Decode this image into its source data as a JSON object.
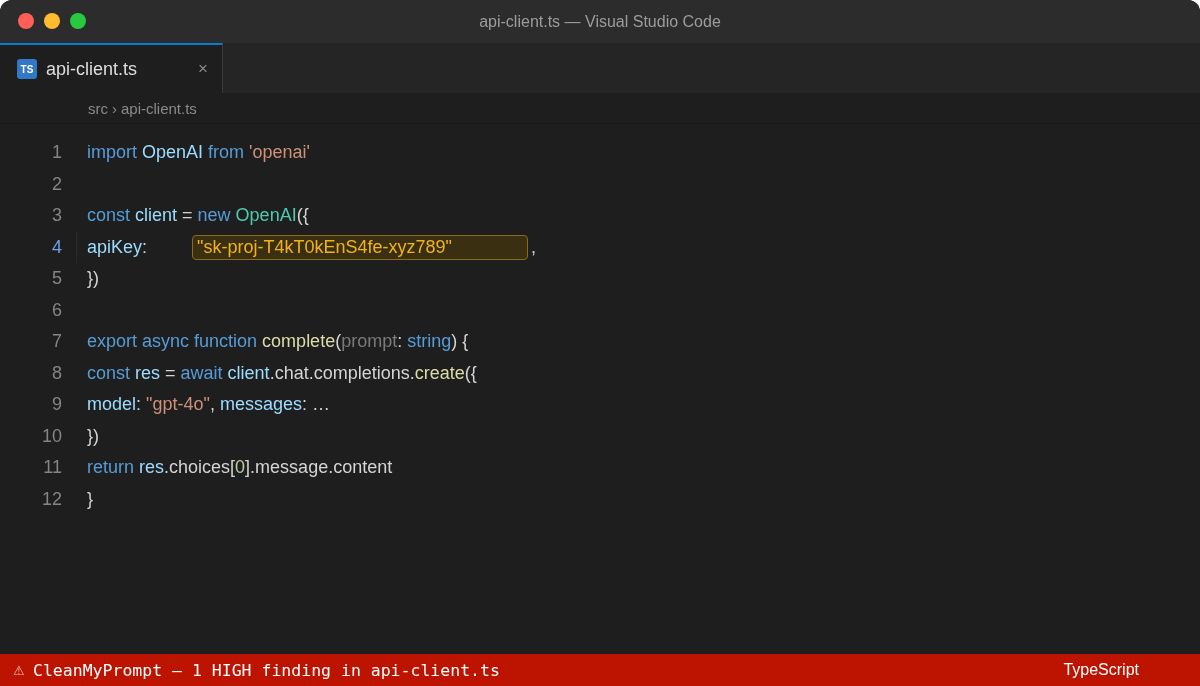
{
  "window": {
    "title": "api-client.ts — Visual Studio Code"
  },
  "tabs": [
    {
      "label": "api-client.ts",
      "icon_label": "TS",
      "close": "×",
      "selected": true
    }
  ],
  "breadcrumb": {
    "items": [
      "src",
      "api-client.ts"
    ],
    "separator": "›"
  },
  "lines": [
    {
      "number": "1",
      "active": false,
      "tokens": [
        {
          "text": "import ",
          "kind": "keyword"
        },
        {
          "text": "OpenAI ",
          "kind": "variable"
        },
        {
          "text": "from ",
          "kind": "keyword"
        },
        {
          "text": "'openai'",
          "kind": "string"
        }
      ]
    },
    {
      "number": "2",
      "active": false
    },
    {
      "number": "3",
      "active": false,
      "tokens": [
        {
          "text": "const ",
          "kind": "keyword"
        },
        {
          "text": "client ",
          "kind": "variable"
        },
        {
          "text": "= ",
          "kind": "plain"
        },
        {
          "text": "new ",
          "kind": "keyword"
        },
        {
          "text": "OpenAI",
          "kind": "type"
        },
        {
          "text": "({",
          "kind": "plain"
        }
      ]
    },
    {
      "number": "4",
      "active": true,
      "tokens": [
        {
          "text": "apiKey",
          "kind": "variable"
        },
        {
          "text": ":",
          "kind": "plain"
        },
        {
          "text": "\"sk-proj-T4kT0kEnS4fe-xyz789\"",
          "kind": "secret"
        },
        {
          "text": ",",
          "kind": "plain"
        }
      ]
    },
    {
      "number": "5",
      "active": false,
      "tokens": [
        {
          "text": "})",
          "kind": "plain"
        }
      ]
    },
    {
      "number": "6",
      "active": false
    },
    {
      "number": "7",
      "active": false,
      "tokens": [
        {
          "text": "export async function ",
          "kind": "keyword"
        },
        {
          "text": "complete",
          "kind": "function"
        },
        {
          "text": "(",
          "kind": "plain"
        },
        {
          "text": "prompt",
          "kind": "parameter"
        },
        {
          "text": ": ",
          "kind": "plain"
        },
        {
          "text": "string",
          "kind": "keyword"
        },
        {
          "text": ") {",
          "kind": "plain"
        }
      ]
    },
    {
      "number": "8",
      "active": false,
      "tokens": [
        {
          "text": "const ",
          "kind": "keyword"
        },
        {
          "text": "res ",
          "kind": "variable"
        },
        {
          "text": "= ",
          "kind": "plain"
        },
        {
          "text": "await ",
          "kind": "keyword"
        },
        {
          "text": "client",
          "kind": "variable"
        },
        {
          "text": ".chat.completions.",
          "kind": "plain"
        },
        {
          "text": "create",
          "kind": "function"
        },
        {
          "text": "({",
          "kind": "plain"
        }
      ]
    },
    {
      "number": "9",
      "active": false,
      "tokens": [
        {
          "text": "model",
          "kind": "variable"
        },
        {
          "text": ": ",
          "kind": "plain"
        },
        {
          "text": "\"gpt-4o\"",
          "kind": "string"
        },
        {
          "text": ", ",
          "kind": "plain"
        },
        {
          "text": "messages",
          "kind": "variable"
        },
        {
          "text": ": …",
          "kind": "plain"
        }
      ]
    },
    {
      "number": "10",
      "active": false,
      "tokens": [
        {
          "text": "})",
          "kind": "plain"
        }
      ]
    },
    {
      "number": "11",
      "active": false,
      "tokens": [
        {
          "text": "return ",
          "kind": "keyword"
        },
        {
          "text": "res",
          "kind": "variable"
        },
        {
          "text": ".choices[",
          "kind": "plain"
        },
        {
          "text": "0",
          "kind": "number"
        },
        {
          "text": "].message.content",
          "kind": "plain"
        }
      ]
    },
    {
      "number": "12",
      "active": false,
      "tokens": [
        {
          "text": "}",
          "kind": "plain"
        }
      ]
    }
  ],
  "status_bar": {
    "icon": "⚠",
    "message": "CleanMyPrompt — 1 HIGH finding in api-client.ts",
    "language": "TypeScript"
  }
}
